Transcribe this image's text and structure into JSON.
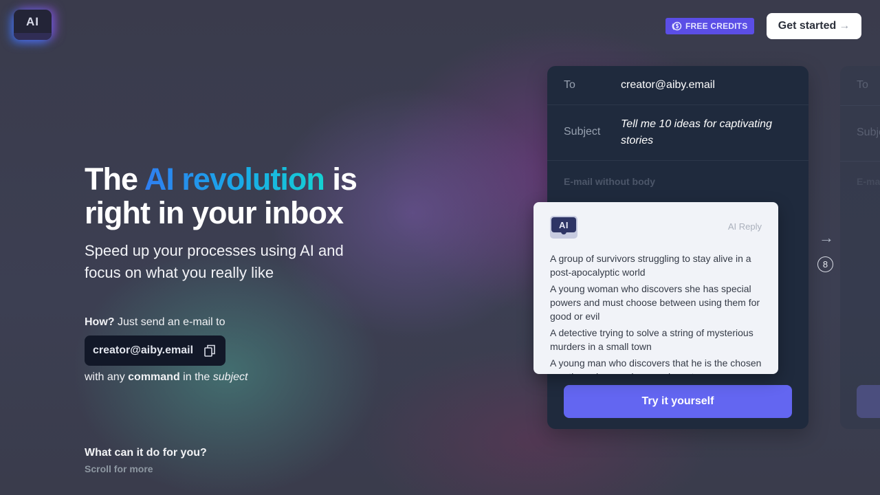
{
  "header": {
    "logo_text": "AI",
    "credits_label": "FREE CREDITS",
    "credits_icon": "coin-icon",
    "get_started_label": "Get started",
    "get_started_icon": "arrow-right-icon"
  },
  "hero": {
    "title_pre": "The ",
    "title_highlight": "AI revolution",
    "title_post": " is right in your inbox",
    "subtitle": "Speed up your processes using AI and focus on what you really like",
    "how_bold": "How?",
    "how_text": " Just send an e-mail to",
    "email": "creator@aiby.email",
    "copy_icon": "copy-icon",
    "with_any_pre": "with any ",
    "with_any_bold": "command",
    "with_any_mid": " in the ",
    "with_any_italic": "subject",
    "what_can": "What can it do for you?",
    "scroll_more": "Scroll for more"
  },
  "email_card": {
    "to_label": "To",
    "to_value": "creator@aiby.email",
    "subject_label": "Subject",
    "subject_value": "Tell me 10 ideas for captivating stories",
    "body_placeholder": "E-mail without body",
    "cta_label": "Try it yourself"
  },
  "ai_reply": {
    "icon_text": "AI",
    "label": "AI Reply",
    "items": [
      "A group of survivors struggling to stay alive in a post-apocalyptic world",
      "A young woman who discovers she has special powers and must choose between using them for good or evil",
      "A detective trying to solve a string of mysterious murders in a small town",
      "A young man who discovers that he is the chosen one through a prophecy and must..."
    ]
  },
  "carousel": {
    "next_icon": "arrow-right-icon",
    "count": "8"
  },
  "next_card": {
    "to_label": "To",
    "subject_label": "Subject",
    "body_placeholder": "E-mail without body"
  },
  "colors": {
    "accent": "#6366f1",
    "credits_badge": "#5b4ee6",
    "card_bg": "#1f2a3d",
    "gradient_start": "#2f7ef0",
    "gradient_end": "#15d2d2"
  }
}
